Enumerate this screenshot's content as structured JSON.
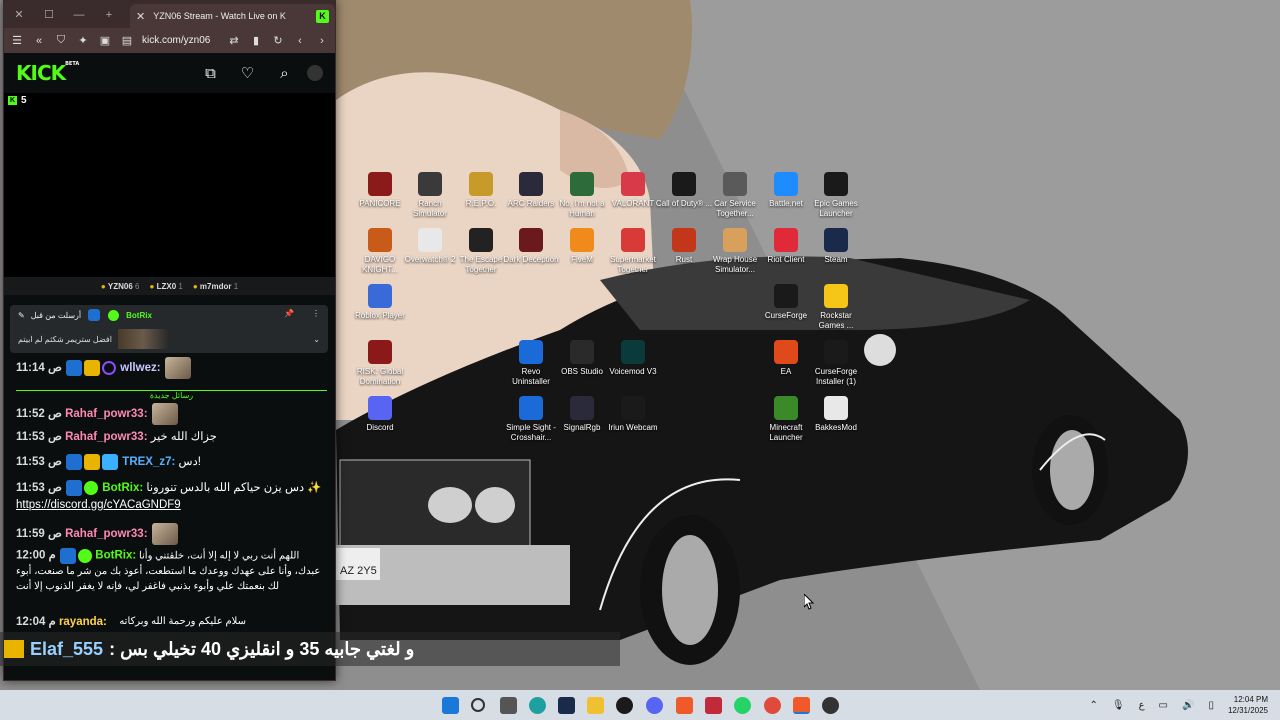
{
  "browser": {
    "tab_title": "YZN06 Stream - Watch Live on K",
    "url": "kick.com/yzn06",
    "window_controls": [
      "close",
      "maximize",
      "minimize"
    ],
    "new_tab": "+"
  },
  "kick": {
    "logo": "KICK",
    "logo_badge": "BETA",
    "viewer_count": "5",
    "leaderboard": [
      {
        "name": "YZN06",
        "value": "6"
      },
      {
        "name": "LZX0",
        "value": "1"
      },
      {
        "name": "m7mdor",
        "value": "1"
      }
    ]
  },
  "pinned": {
    "pinned_by": "أرسلت من قبل",
    "user": "BotRix",
    "text": "افضل ستريمر شكثم لم ابيتم"
  },
  "chat": {
    "new_messages_label": "رسائل جديدة",
    "messages": [
      {
        "time": "11:14 ص",
        "user": "wllwez:",
        "text": ""
      },
      {
        "time": "11:52 ص",
        "user": "Rahaf_powr33:",
        "text": ""
      },
      {
        "time": "11:53 ص",
        "user": "Rahaf_powr33:",
        "text": "جزاك الله خير"
      },
      {
        "time": "11:53 ص",
        "user": "TREX_z7:",
        "text": "دس!"
      },
      {
        "time": "11:53 ص",
        "user": "BotRix:",
        "text": "دس يزن حياكم الله بالدس تنورونا ✨",
        "link": "https://discord.gg/cYACaGNDF9"
      },
      {
        "time": "11:59 ص",
        "user": "Rahaf_powr33:",
        "text": ""
      },
      {
        "time": "12:00 م",
        "user": "BotRix:",
        "text": "اللهم أنت ربي لا إله إلا أنت، خلقتني وأنا عبدك، وأنا على عهدك ووعدك ما استطعت، أعوذ بك من شر ما صنعت، أبوء لك بنعمتك علي وأبوء بذنبي فاغفر لي، فإنه لا يغفر الذنوب إلا أنت"
      },
      {
        "time": "",
        "user": "",
        "text": "سلام عليكم ورحمة الله وبركاته"
      },
      {
        "time": "12:04 م",
        "user": "rayanda:",
        "text": ""
      }
    ]
  },
  "overlay": {
    "user": "Elaf_555",
    "text": ": و لغتي جابيه 35 و انقليزي 40 تخيلي بس"
  },
  "desktop_icons": [
    {
      "label": "PANICORE",
      "color": "#8b1a1a"
    },
    {
      "label": "Ranch Simulator",
      "color": "#3a3a3a"
    },
    {
      "label": "R.E.P.O.",
      "color": "#c79a2a"
    },
    {
      "label": "ARC Raiders",
      "color": "#2a2a3a"
    },
    {
      "label": "No, I'm not a Human",
      "color": "#2e6b3a"
    },
    {
      "label": "VALORANT",
      "color": "#d83a4a"
    },
    {
      "label": "Call of Duty® ...",
      "color": "#1a1a1a"
    },
    {
      "label": "Car Service Together...",
      "color": "#5a5a5a"
    },
    {
      "label": "Battle.net",
      "color": "#1e8cff"
    },
    {
      "label": "Epic Games Launcher",
      "color": "#1a1a1a"
    },
    {
      "label": "DAVIGO KNIGHT...",
      "color": "#c85a1a"
    },
    {
      "label": "Overwatch® 2",
      "color": "#e8e8e8"
    },
    {
      "label": "The Escape Together",
      "color": "#222"
    },
    {
      "label": "Dark Deception",
      "color": "#6a1a1a"
    },
    {
      "label": "FiveM",
      "color": "#f08a1a"
    },
    {
      "label": "Supermarket Together",
      "color": "#d83a3a"
    },
    {
      "label": "Rust",
      "color": "#c2361a"
    },
    {
      "label": "Wrap House Simulator...",
      "color": "#d8a05a"
    },
    {
      "label": "Riot Client",
      "color": "#e02a3a"
    },
    {
      "label": "Steam",
      "color": "#1a2a4a"
    },
    {
      "label": "Roblox Player",
      "color": "#3a6ad8"
    },
    {
      "label": "CurseForge",
      "color": "#1a1a1a"
    },
    {
      "label": "Rockstar Games ...",
      "color": "#f5c518"
    },
    {
      "label": "RISK: Global Domination",
      "color": "#8a1a1a"
    },
    {
      "label": "Revo Uninstaller",
      "color": "#1a6ad8"
    },
    {
      "label": "OBS Studio",
      "color": "#2a2a2a"
    },
    {
      "label": "Voicemod V3",
      "color": "#0a3a3a"
    },
    {
      "label": "EA",
      "color": "#e04a1a"
    },
    {
      "label": "CurseForge Installer (1)",
      "color": "#1a1a1a"
    },
    {
      "label": "Discord",
      "color": "#5865f2"
    },
    {
      "label": "Simple Sight - Crosshair...",
      "color": "#1a6ad8"
    },
    {
      "label": "SignalRgb",
      "color": "#2a2a3a"
    },
    {
      "label": "Iriun Webcam",
      "color": "#1a1a1a"
    },
    {
      "label": "Minecraft Launcher",
      "color": "#3a8a2a"
    },
    {
      "label": "BakkesMod",
      "color": "#e8e8e8"
    }
  ],
  "taskbar": {
    "time": "12:04 PM",
    "date": "12/31/2025"
  }
}
